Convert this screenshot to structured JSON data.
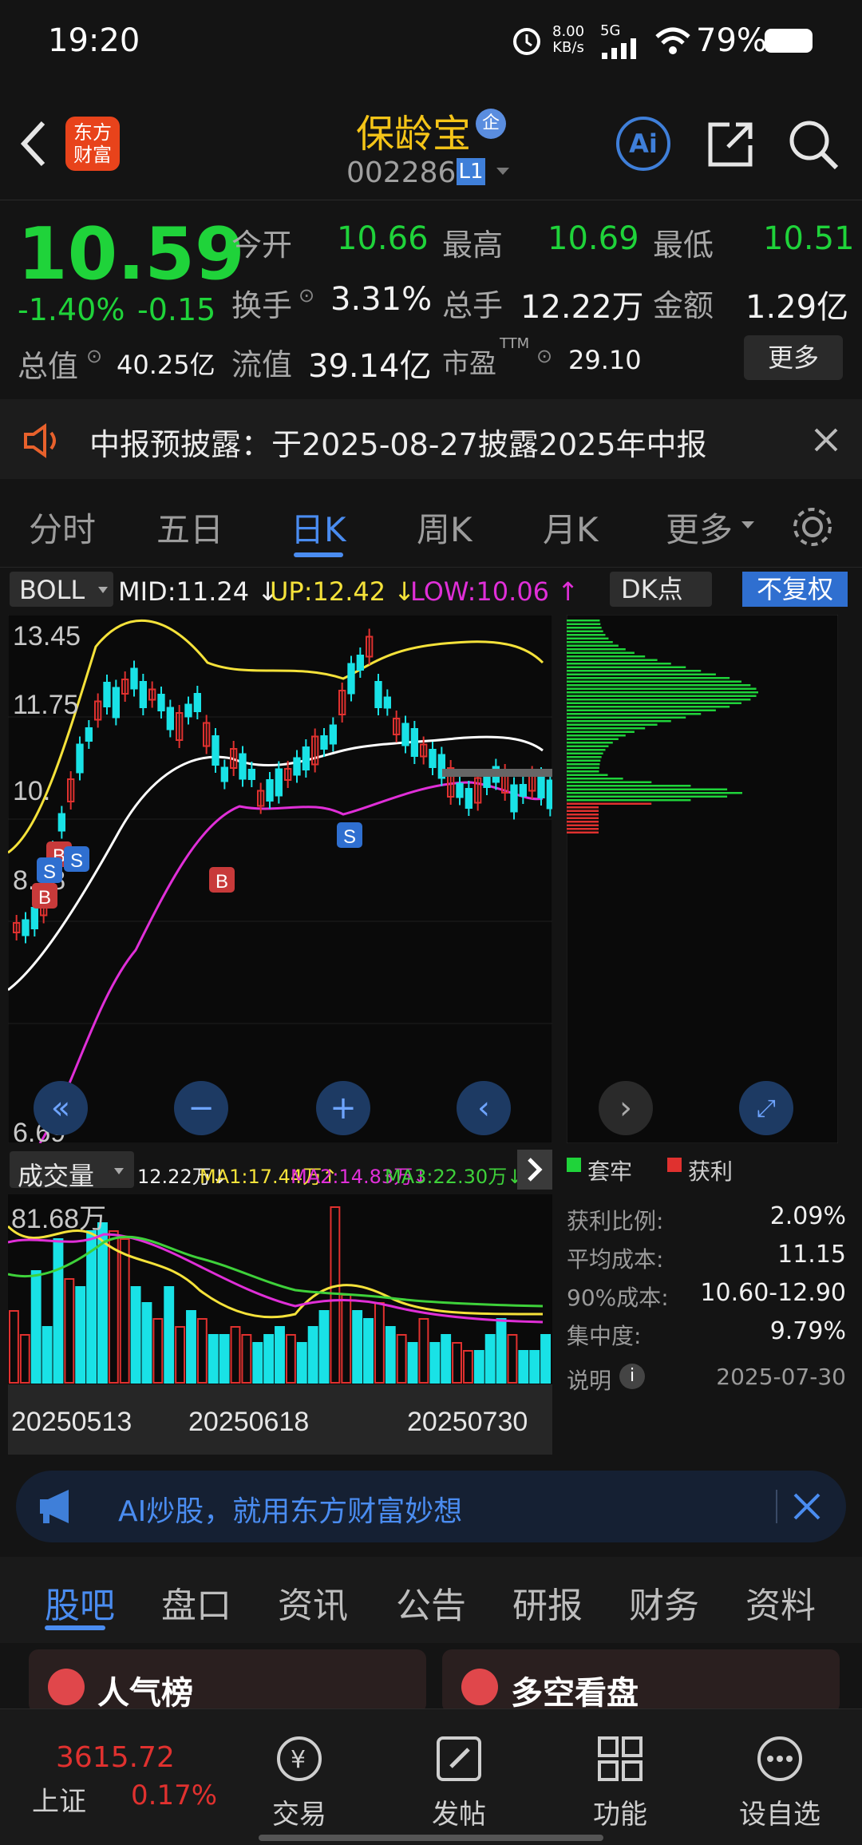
{
  "status": {
    "time": "19:20",
    "net_speed": "8.00",
    "net_unit": "KB/s",
    "signal": "5G",
    "battery": "79%"
  },
  "header": {
    "logo_line1": "东方",
    "logo_line2": "财富",
    "stock_name": "保龄宝",
    "badge": "企",
    "code": "002286",
    "level": "L1",
    "ai": "Ai"
  },
  "quote": {
    "price": "10.59",
    "pct": "-1.40%",
    "chg": "-0.15",
    "open_label": "今开",
    "open": "10.66",
    "high_label": "最高",
    "high": "10.69",
    "low_label": "最低",
    "low": "10.51",
    "turnover_label": "换手",
    "turnover": "3.31%",
    "volume_label": "总手",
    "volume": "12.22万",
    "amount_label": "金额",
    "amount": "1.29亿",
    "mcap_label": "总值",
    "mcap": "40.25亿",
    "float_label": "流值",
    "float": "39.14亿",
    "pe_label": "市盈",
    "pe_sup": "TTM",
    "pe": "29.10",
    "more": "更多"
  },
  "notice": {
    "text": "中报预披露：于2025-08-27披露2025年中报"
  },
  "period_tabs": [
    "分时",
    "五日",
    "日K",
    "周K",
    "月K",
    "更多"
  ],
  "active_tab": "日K",
  "kline": {
    "indicator": "BOLL",
    "mid": "MID:11.24",
    "mid_arrow": "↓",
    "up": "UP:12.42",
    "up_arrow": "↓",
    "low": "LOW:10.06",
    "low_arrow": "↑",
    "dk": "DK点",
    "fuquan": "不复权",
    "y_labels": [
      "13.45",
      "11.75",
      "10.",
      "8.38",
      "6.69"
    ],
    "signals": [
      "B",
      "B",
      "S",
      "S",
      "B",
      "S"
    ]
  },
  "chips": {
    "legend_trapped": "套牢",
    "legend_profit": "获利",
    "rows": [
      {
        "label": "获利比例:",
        "value": "2.09%"
      },
      {
        "label": "平均成本:",
        "value": "11.15"
      },
      {
        "label": "90%成本:",
        "value": "10.60-12.90"
      },
      {
        "label": "集中度:",
        "value": "9.79%"
      }
    ],
    "explain": "说明",
    "date": "2025-07-30"
  },
  "volume": {
    "label": "成交量",
    "v": "12.22万↓",
    "ma1": "MA1:17.44万↑",
    "ma2": "MA2:14.83万↓",
    "ma3": "MA3:22.30万↓",
    "max": "81.68万",
    "dates": [
      "20250513",
      "20250618",
      "20250730"
    ]
  },
  "ai_banner": {
    "text": "AI炒股，就用东方财富妙想"
  },
  "bottom_tabs": [
    "股吧",
    "盘口",
    "资讯",
    "公告",
    "研报",
    "财务",
    "资料"
  ],
  "cards": {
    "left": "人气榜",
    "right": "多空看盘"
  },
  "index": {
    "value": "3615.72",
    "name": "上证",
    "pct": "0.17%"
  },
  "nav": [
    "交易",
    "发帖",
    "功能",
    "设自选"
  ],
  "colors": {
    "up": "#e0312f",
    "down": "#1fd33a",
    "accent": "#3f7fd9",
    "candle_up": "#e0312f",
    "candle_down": "#19e2e6",
    "yellow": "#f5e23a",
    "magenta": "#e02fd8"
  }
}
